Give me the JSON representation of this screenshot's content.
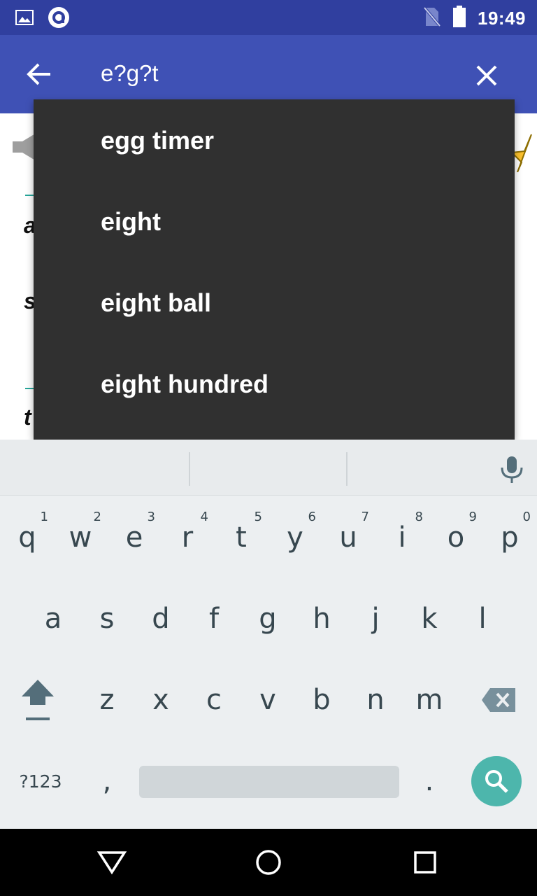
{
  "status_bar": {
    "time": "19:49",
    "icons": [
      "image-icon",
      "app-badge-icon",
      "no-sim-icon",
      "battery-icon"
    ]
  },
  "app_bar": {
    "search_query": "e?g?t",
    "icons": [
      "back-arrow-icon",
      "clear-icon"
    ]
  },
  "background": {
    "letters": [
      "a",
      "s",
      "t"
    ]
  },
  "suggestions": [
    {
      "label": "egg timer"
    },
    {
      "label": "eight"
    },
    {
      "label": "eight ball"
    },
    {
      "label": "eight hundred"
    }
  ],
  "keyboard": {
    "row1": [
      {
        "key": "q",
        "hint": "1"
      },
      {
        "key": "w",
        "hint": "2"
      },
      {
        "key": "e",
        "hint": "3"
      },
      {
        "key": "r",
        "hint": "4"
      },
      {
        "key": "t",
        "hint": "5"
      },
      {
        "key": "y",
        "hint": "6"
      },
      {
        "key": "u",
        "hint": "7"
      },
      {
        "key": "i",
        "hint": "8"
      },
      {
        "key": "o",
        "hint": "9"
      },
      {
        "key": "p",
        "hint": "0"
      }
    ],
    "row2": [
      "a",
      "s",
      "d",
      "f",
      "g",
      "h",
      "j",
      "k",
      "l"
    ],
    "row3": [
      "z",
      "x",
      "c",
      "v",
      "b",
      "n",
      "m"
    ],
    "symbols_label": "?123",
    "comma": ",",
    "period": ".",
    "accent_color": "#4db6ac"
  },
  "colors": {
    "status_bar": "#303f9f",
    "app_bar": "#3f51b5",
    "dropdown": "#303030",
    "keyboard": "#eceff1"
  }
}
